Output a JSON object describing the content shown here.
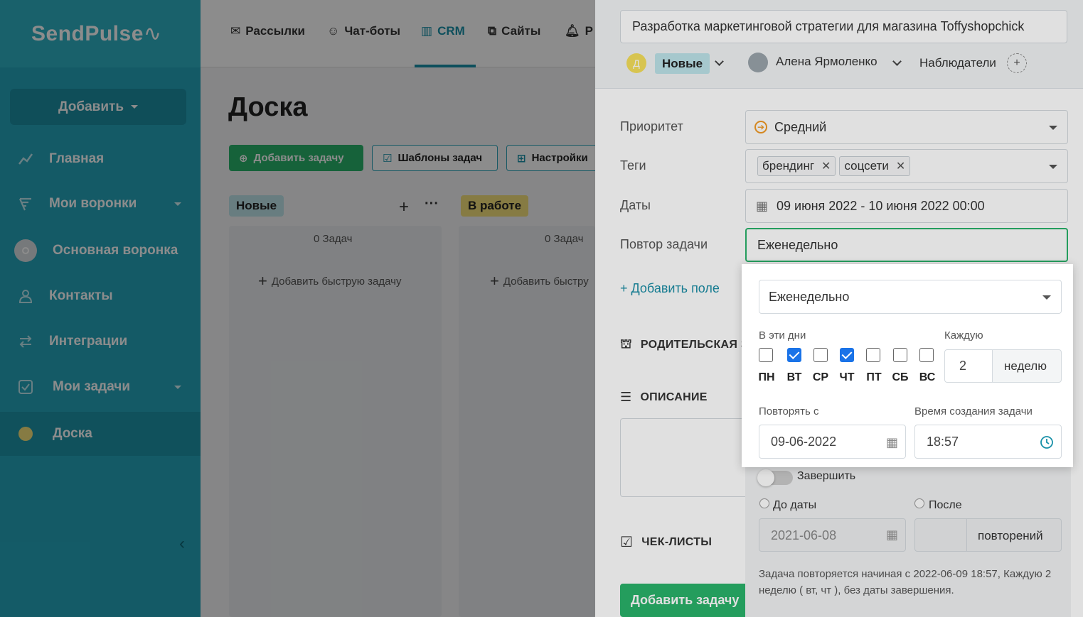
{
  "sidebar": {
    "logo": "SendPulse",
    "add_button": "Добавить",
    "items": [
      {
        "label": "Главная",
        "icon": "chart-line-icon"
      },
      {
        "label": "Мои воронки",
        "icon": "funnel-icon"
      },
      {
        "label": "Основная воронка",
        "icon": "avatar-circle-icon"
      },
      {
        "label": "Контакты",
        "icon": "contacts-icon"
      },
      {
        "label": "Интеграции",
        "icon": "arrows-icon"
      },
      {
        "label": "Мои задачи",
        "icon": "task-check-icon"
      },
      {
        "label": "Доска",
        "icon": "dot-icon"
      }
    ]
  },
  "topnav": {
    "items": [
      "Рассылки",
      "Чат-боты",
      "CRM",
      "Сайты",
      "Р"
    ]
  },
  "board": {
    "title": "Доска",
    "add_task": "Добавить задачу",
    "templates": "Шаблоны задач",
    "settings": "Настройки",
    "columns": [
      {
        "name": "Новые",
        "count": "0 Задач",
        "quick_add": "Добавить быструю задачу"
      },
      {
        "name": "В работе",
        "count": "0 Задач",
        "quick_add": "Добавить быстру"
      }
    ]
  },
  "panel": {
    "task_title": "Разработка маркетинговой стратегии для магазина Toffyshopchick",
    "status_avatar": "Д",
    "status": "Новые",
    "assignee": "Алена Ярмоленко",
    "observers": "Наблюдатели",
    "labels": {
      "priority": "Приоритет",
      "tags": "Теги",
      "dates": "Даты",
      "repeat": "Повтор задачи"
    },
    "priority": "Средний",
    "tags": [
      "брендинг",
      "соцсети"
    ],
    "dates": "09 июня 2022 - 10 июня 2022 00:00",
    "repeat": "Еженедельно",
    "add_field": "+ Добавить поле",
    "sections": {
      "parent": "РОДИТЕЛЬСКАЯ З",
      "description": "ОПИСАНИЕ",
      "checklists": "ЧЕК-ЛИСТЫ"
    },
    "add_task_button": "Добавить задачу"
  },
  "repeat_popup": {
    "frequency": "Еженедельно",
    "days_label": "В эти дни",
    "every_label": "Каждую",
    "days": [
      {
        "label": "ПН",
        "checked": false
      },
      {
        "label": "ВТ",
        "checked": true
      },
      {
        "label": "СР",
        "checked": false
      },
      {
        "label": "ЧТ",
        "checked": true
      },
      {
        "label": "ПТ",
        "checked": false
      },
      {
        "label": "СБ",
        "checked": false
      },
      {
        "label": "ВС",
        "checked": false
      }
    ],
    "every_value": "2",
    "every_unit": "неделю",
    "repeat_from_label": "Повторять с",
    "repeat_from": "09-06-2022",
    "time_label": "Время создания задачи",
    "time": "18:57"
  },
  "end_options": {
    "finish_label": "Завершить",
    "until_date_label": "До даты",
    "after_label": "После",
    "until_date": "2021-06-08",
    "after_unit": "повторений",
    "summary": "Задача повторяется начиная с 2022-06-09 18:57, Каждую 2 неделю ( вт, чт ), без даты завершения."
  },
  "colors": {
    "sidebar": "#25a5bb",
    "accent": "#1890a8",
    "green": "#29b36a",
    "checkbox": "#1a73e8"
  }
}
